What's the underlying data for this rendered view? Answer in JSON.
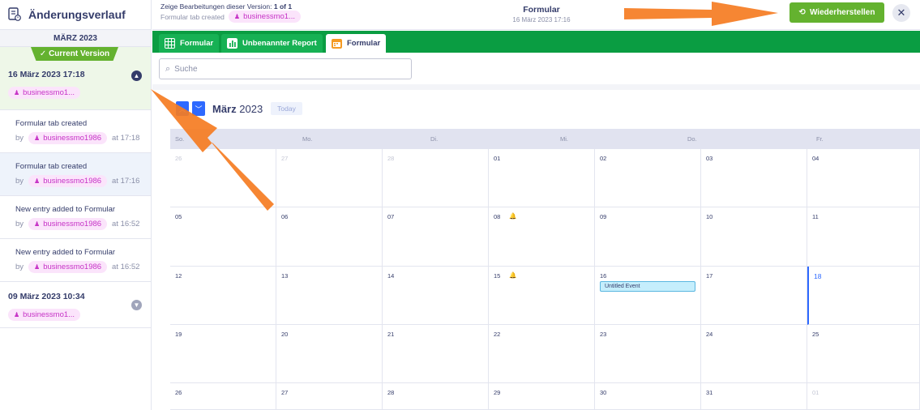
{
  "sidebar": {
    "title": "Änderungsverlauf",
    "month": "MÄRZ 2023",
    "current_badge": "✓ Current Version",
    "current_version": {
      "date": "16 März 2023 17:18",
      "user": "businessmo1..."
    },
    "events": [
      {
        "title": "Formular tab created",
        "by": "by",
        "user": "businessmo1986",
        "time": "at 17:18"
      },
      {
        "title": "Formular tab created",
        "by": "by",
        "user": "businessmo1986",
        "time": "at 17:16"
      },
      {
        "title": "New entry added to Formular",
        "by": "by",
        "user": "businessmo1986",
        "time": "at 16:52"
      },
      {
        "title": "New entry added to Formular",
        "by": "by",
        "user": "businessmo1986",
        "time": "at 16:52"
      }
    ],
    "older_version": {
      "date": "09 März 2023 10:34",
      "user": "businessmo1..."
    }
  },
  "topbar": {
    "info_label": "Zeige Bearbeitungen dieser Version:",
    "info_count": "1 of 1",
    "sub_text": "Formular tab created",
    "sub_user": "businessmo1...",
    "center_title": "Formular",
    "center_date": "16 März 2023 17:16",
    "restore_label": "Wiederherstellen",
    "close_label": "✕"
  },
  "tabs": [
    {
      "label": "Formular",
      "icon": "table-icon"
    },
    {
      "label": "Unbenannter Report",
      "icon": "report-icon"
    },
    {
      "label": "Formular",
      "icon": "calendar-icon",
      "active": true
    }
  ],
  "search": {
    "placeholder": "Suche"
  },
  "calendar": {
    "month_label": "März",
    "year_label": "2023",
    "today_label": "Today",
    "weekdays": [
      "So.",
      "Mo.",
      "Di.",
      "Mi.",
      "Do.",
      "Fr."
    ],
    "weeks": [
      [
        "26",
        "27",
        "28",
        "01",
        "02",
        "03",
        "04"
      ],
      [
        "05",
        "06",
        "07",
        "08",
        "09",
        "10",
        "11"
      ],
      [
        "12",
        "13",
        "14",
        "15",
        "16",
        "17",
        "18"
      ],
      [
        "19",
        "20",
        "21",
        "22",
        "23",
        "24",
        "25"
      ],
      [
        "26",
        "27",
        "28",
        "29",
        "30",
        "31",
        "01"
      ]
    ],
    "event_label": "Untitled Event"
  },
  "colors": {
    "accent_green": "#64b22f",
    "tab_green": "#0a9d42",
    "blue": "#2e69ff",
    "arrow": "#f57c22"
  }
}
